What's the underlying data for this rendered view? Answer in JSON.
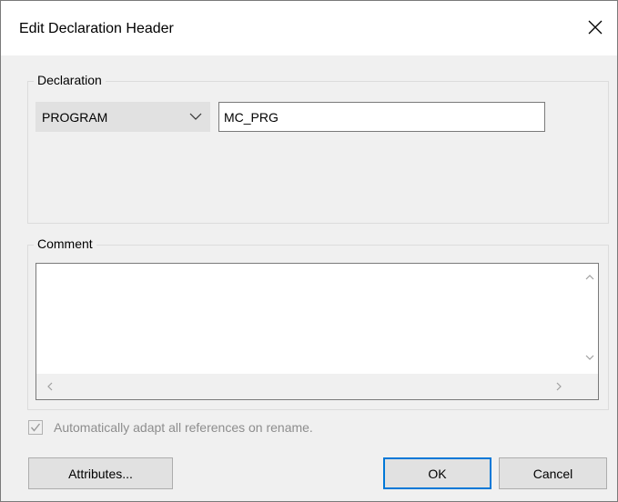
{
  "dialog": {
    "title": "Edit Declaration Header"
  },
  "declaration": {
    "group_label": "Declaration",
    "type_selected": "PROGRAM",
    "name_value": "MC_PRG"
  },
  "comment": {
    "group_label": "Comment",
    "value": ""
  },
  "options": {
    "adapt_references_label": "Automatically adapt all references on rename.",
    "adapt_references_checked": true
  },
  "buttons": {
    "attributes_label": "Attributes...",
    "ok_label": "OK",
    "cancel_label": "Cancel"
  },
  "icons": {
    "close": "close-icon",
    "dropdown": "chevron-down-icon",
    "check": "checkmark-icon"
  }
}
